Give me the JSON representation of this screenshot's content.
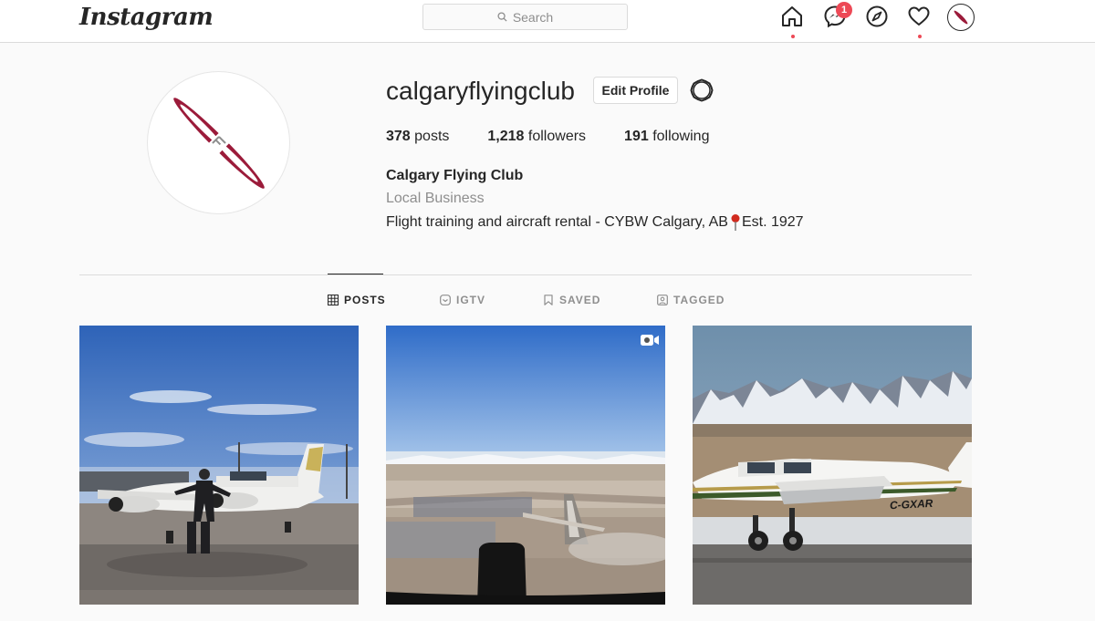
{
  "app": {
    "logo_text": "Instagram"
  },
  "search": {
    "placeholder": "Search"
  },
  "nav": {
    "icons": [
      "home-icon",
      "messenger-icon",
      "explore-icon",
      "activity-heart-icon",
      "profile-avatar"
    ],
    "messages_badge": "1",
    "accent_color": "#ed4956"
  },
  "profile": {
    "username": "calgaryflyingclub",
    "edit_label": "Edit Profile",
    "stats": {
      "posts_count": "378",
      "posts_label": "posts",
      "followers_count": "1,218",
      "followers_label": "followers",
      "following_count": "191",
      "following_label": "following"
    },
    "full_name": "Calgary Flying Club",
    "category": "Local Business",
    "bio_main": "Flight training and aircraft rental - CYBW Calgary, AB",
    "bio_icon": "round-pushpin-emoji",
    "bio_tail": "Est. 1927",
    "brand_color": "#9b1b3a"
  },
  "tabs": [
    {
      "label": "POSTS",
      "icon": "grid-icon",
      "active": true
    },
    {
      "label": "IGTV",
      "icon": "igtv-icon",
      "active": false
    },
    {
      "label": "SAVED",
      "icon": "bookmark-icon",
      "active": false
    },
    {
      "label": "TAGGED",
      "icon": "tagged-icon",
      "active": false
    }
  ],
  "posts": [
    {
      "subject": "pilot-with-plane",
      "video": false
    },
    {
      "subject": "aerial-approach-view",
      "video": true
    },
    {
      "subject": "plane-mountains",
      "video": false
    }
  ],
  "aircraft_registration": "C-GXAR"
}
